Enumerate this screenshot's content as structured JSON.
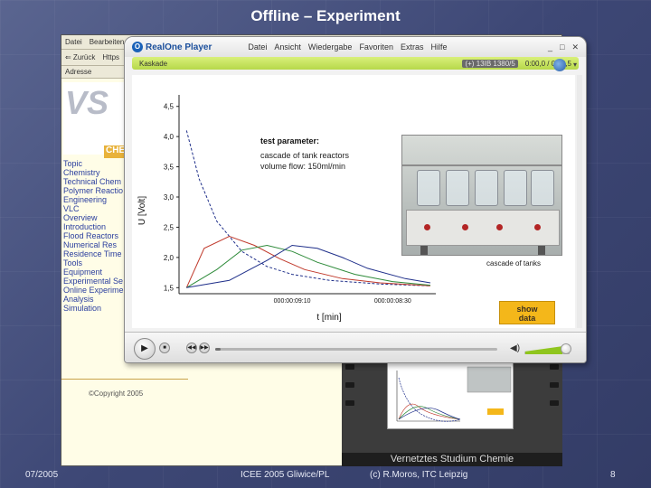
{
  "slide": {
    "title": "Offline – Experiment",
    "footer_date": "07/2005",
    "footer_event": "ICEE 2005 Gliwice/PL",
    "footer_author": "(c) R.Moros, ITC Leipzig",
    "footer_page": "8"
  },
  "browser": {
    "menu": [
      "Datei",
      "Bearbeiten"
    ],
    "toolbar_back": "⇐ Zurück",
    "toolbar_fav": "Https",
    "address_label": "Adresse",
    "logo_text": "VS",
    "logo_chem": "CHE",
    "nav": [
      "Topic",
      "Chemistry",
      "Technical Chem",
      "Polymer Reactio",
      "Engineering",
      "VLC",
      "Overview",
      "Introduction",
      "Flood Reactors",
      "Numerical Res",
      "Residence Time",
      "Tools",
      "Equipment",
      "Experimental Se",
      "Online Experime",
      "Analysis",
      "Simulation"
    ],
    "copyright": "©Copyright 2005",
    "film_label": "Vernetztes Studium Chemie"
  },
  "player": {
    "brand": "RealOne Player",
    "menus": [
      "Datei",
      "Ansicht",
      "Wiedergabe",
      "Favoriten",
      "Extras",
      "Hilfe"
    ],
    "window_controls": [
      "_",
      "□",
      "✕"
    ],
    "clip_title": "Kaskade",
    "status_mode": "(+) 13IB 1380/5",
    "timecode": "0:00,0 / 0:06,5",
    "params_title": "test parameter:",
    "params_lines": [
      "cascade of tank reactors",
      "volume flow: 150ml/min"
    ],
    "photo_caption": "cascade of tanks",
    "show_data_line1": "show",
    "show_data_line2": "data",
    "seek_progress": 0.02,
    "volume_level": 0.85
  },
  "chart_data": {
    "type": "line",
    "title": "",
    "xlabel": "t [min]",
    "ylabel": "U [Volt]",
    "ylim": [
      1.4,
      4.6
    ],
    "yticks": [
      "4,5",
      "4,0",
      "3,5",
      "3,0",
      "2,5",
      "2,0",
      "1,5"
    ],
    "ytick_values": [
      4.5,
      4.0,
      3.5,
      3.0,
      2.5,
      2.0,
      1.5
    ],
    "xlim": [
      0,
      10
    ],
    "xticks": [
      "000:00:09:10",
      "000:00:08:30"
    ],
    "xtick_values": [
      4.5,
      8.5
    ],
    "series": [
      {
        "color": "#1f2f8a",
        "dashed": true,
        "x": [
          0.3,
          0.8,
          1.5,
          2.5,
          3.5,
          4.5,
          6,
          8,
          10
        ],
        "y": [
          4.1,
          3.3,
          2.6,
          2.1,
          1.85,
          1.72,
          1.62,
          1.56,
          1.53
        ]
      },
      {
        "color": "#c0392b",
        "x": [
          0.3,
          1.0,
          2.0,
          3.0,
          4.0,
          5.0,
          6.5,
          8,
          10
        ],
        "y": [
          1.5,
          2.15,
          2.35,
          2.2,
          1.98,
          1.8,
          1.65,
          1.58,
          1.53
        ]
      },
      {
        "color": "#2e8b3a",
        "x": [
          0.3,
          1.5,
          2.5,
          3.5,
          4.5,
          5.5,
          7,
          8.5,
          10
        ],
        "y": [
          1.5,
          1.8,
          2.12,
          2.2,
          2.1,
          1.92,
          1.72,
          1.6,
          1.54
        ]
      },
      {
        "color": "#1f2f8a",
        "x": [
          0.3,
          2.0,
          3.5,
          4.5,
          5.5,
          6.5,
          7.5,
          9,
          10
        ],
        "y": [
          1.5,
          1.62,
          1.95,
          2.2,
          2.15,
          2.0,
          1.82,
          1.65,
          1.58
        ]
      }
    ]
  },
  "colors": {
    "slide_bg": "#3a4470",
    "player_bar": "#b6d84a",
    "show_data": "#f4b71a"
  }
}
